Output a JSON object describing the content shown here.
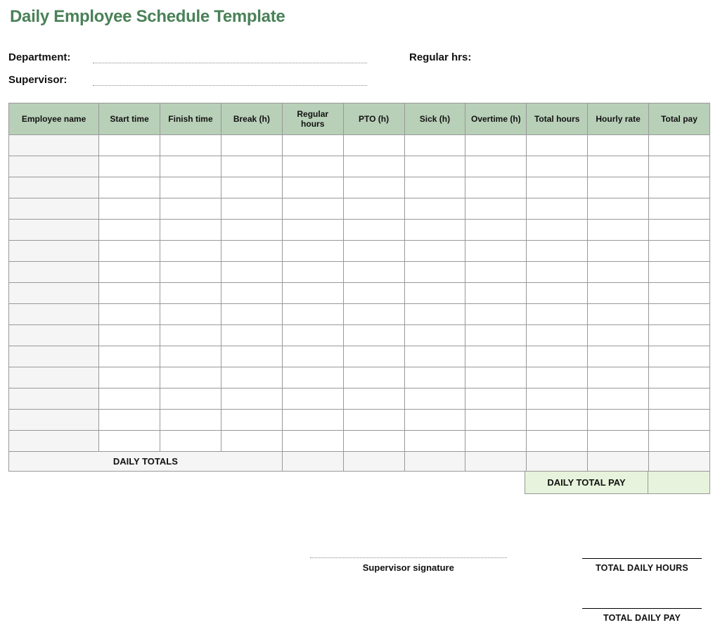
{
  "title": "Daily Employee Schedule Template",
  "meta": {
    "department_label": "Department:",
    "department_value": "",
    "regular_hrs_label": "Regular hrs:",
    "regular_hrs_value": "",
    "supervisor_label": "Supervisor:",
    "supervisor_value": ""
  },
  "columns": [
    "Employee name",
    "Start time",
    "Finish time",
    "Break (h)",
    "Regular hours",
    "PTO (h)",
    "Sick (h)",
    "Overtime (h)",
    "Total hours",
    "Hourly rate",
    "Total pay"
  ],
  "rows": [
    [
      "",
      "",
      "",
      "",
      "",
      "",
      "",
      "",
      "",
      "",
      ""
    ],
    [
      "",
      "",
      "",
      "",
      "",
      "",
      "",
      "",
      "",
      "",
      ""
    ],
    [
      "",
      "",
      "",
      "",
      "",
      "",
      "",
      "",
      "",
      "",
      ""
    ],
    [
      "",
      "",
      "",
      "",
      "",
      "",
      "",
      "",
      "",
      "",
      ""
    ],
    [
      "",
      "",
      "",
      "",
      "",
      "",
      "",
      "",
      "",
      "",
      ""
    ],
    [
      "",
      "",
      "",
      "",
      "",
      "",
      "",
      "",
      "",
      "",
      ""
    ],
    [
      "",
      "",
      "",
      "",
      "",
      "",
      "",
      "",
      "",
      "",
      ""
    ],
    [
      "",
      "",
      "",
      "",
      "",
      "",
      "",
      "",
      "",
      "",
      ""
    ],
    [
      "",
      "",
      "",
      "",
      "",
      "",
      "",
      "",
      "",
      "",
      ""
    ],
    [
      "",
      "",
      "",
      "",
      "",
      "",
      "",
      "",
      "",
      "",
      ""
    ],
    [
      "",
      "",
      "",
      "",
      "",
      "",
      "",
      "",
      "",
      "",
      ""
    ],
    [
      "",
      "",
      "",
      "",
      "",
      "",
      "",
      "",
      "",
      "",
      ""
    ],
    [
      "",
      "",
      "",
      "",
      "",
      "",
      "",
      "",
      "",
      "",
      ""
    ],
    [
      "",
      "",
      "",
      "",
      "",
      "",
      "",
      "",
      "",
      "",
      ""
    ],
    [
      "",
      "",
      "",
      "",
      "",
      "",
      "",
      "",
      "",
      "",
      ""
    ]
  ],
  "daily_totals_label": "DAILY TOTALS",
  "daily_totals": [
    "",
    "",
    "",
    "",
    "",
    "",
    ""
  ],
  "daily_total_pay_label": "DAILY TOTAL PAY",
  "daily_total_pay_value": "",
  "supervisor_signature_label": "Supervisor signature",
  "total_daily_hours_label": "TOTAL DAILY HOURS",
  "total_daily_hours_value": "",
  "total_daily_pay_label": "TOTAL DAILY PAY",
  "total_daily_pay_value": ""
}
